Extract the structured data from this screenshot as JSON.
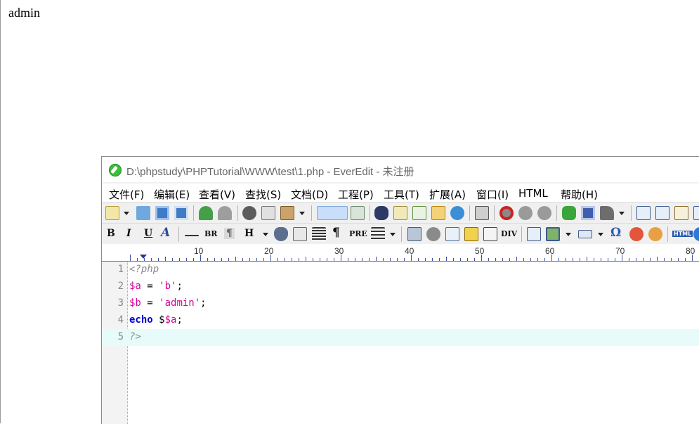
{
  "browser": {
    "output_text": "admin"
  },
  "editor": {
    "title": "D:\\phpstudy\\PHPTutorial\\WWW\\test\\1.php - EverEdit - 未注册",
    "menu": [
      "文件(F)",
      "编辑(E)",
      "查看(V)",
      "查找(S)",
      "文档(D)",
      "工程(P)",
      "工具(T)",
      "扩展(A)",
      "窗口(I)",
      "HTML",
      "帮助(H)"
    ],
    "toolbar2_text": {
      "bold": "B",
      "italic": "I",
      "underline": "U",
      "font": "A",
      "br": "BR",
      "pilcrow": "¶",
      "heading": "H",
      "pre": "PRE",
      "div": "DIV",
      "omega": "Ω",
      "html": "HTML"
    },
    "ruler_labels": [
      "10",
      "20",
      "30",
      "40",
      "50",
      "60",
      "70",
      "80"
    ],
    "line_numbers": [
      "1",
      "2",
      "3",
      "4",
      "5"
    ],
    "code": {
      "l1": "<?php",
      "l2_var": "$a",
      "l2_op": " = ",
      "l2_str": "'b'",
      "l2_end": ";",
      "l3_var": "$b",
      "l3_op": " = ",
      "l3_str": "'admin'",
      "l3_end": ";",
      "l4_kw": "echo",
      "l4_sp": " $",
      "l4_var": "$a",
      "l4_end": ";",
      "l5": "?>"
    },
    "colors": {
      "accent_selected": "#c9defa",
      "current_line": "#e7fbfb",
      "string": "#d6009c",
      "keyword": "#0000cc"
    }
  }
}
